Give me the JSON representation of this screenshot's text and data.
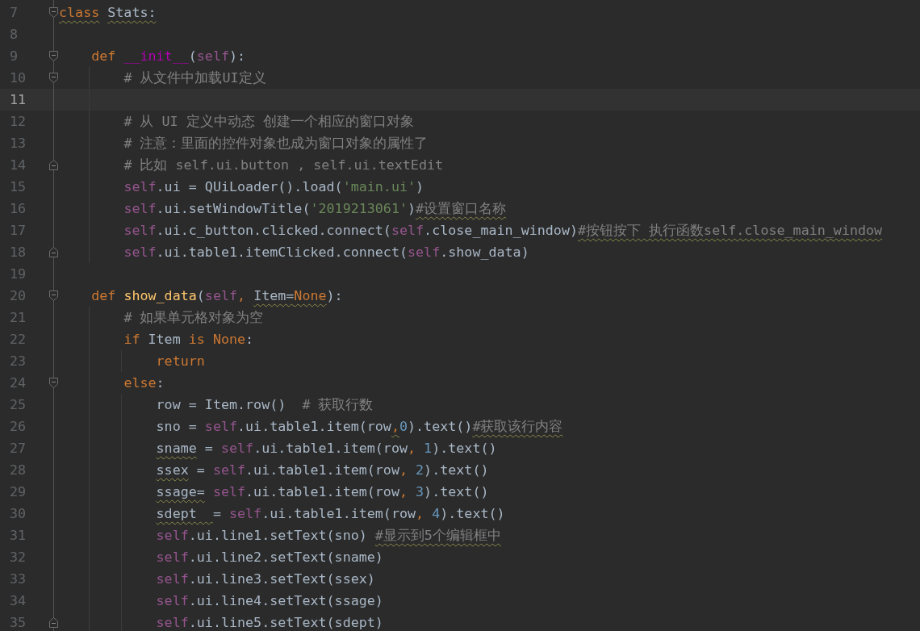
{
  "editor": {
    "lines": [
      {
        "number": "7",
        "kind": "fold-start",
        "selected": false,
        "tokens": [
          {
            "kind": "keyword",
            "text": "class",
            "wavy": true
          },
          {
            "kind": "plain",
            "text": " Stats:",
            "wavy": true
          }
        ]
      },
      {
        "number": "8",
        "kind": "plain",
        "selected": false
      },
      {
        "number": "9",
        "kind": "fold-start",
        "selected": false,
        "tokens": [
          {
            "kind": "keyword",
            "text": "    def "
          },
          {
            "kind": "magic",
            "text": "__init__"
          },
          {
            "kind": "plain",
            "text": "("
          },
          {
            "kind": "self",
            "text": "self"
          },
          {
            "kind": "plain",
            "text": "):"
          }
        ]
      },
      {
        "number": "10",
        "kind": "fold-start",
        "selected": false,
        "tokens": [
          {
            "kind": "comment",
            "text": "        # 从文件中加载UI定义"
          }
        ]
      },
      {
        "number": "11",
        "kind": "plain",
        "selected": true
      },
      {
        "number": "12",
        "kind": "plain",
        "selected": false,
        "tokens": [
          {
            "kind": "comment",
            "text": "        # 从 UI 定义中动态 创建一个相应的窗口对象"
          }
        ]
      },
      {
        "number": "13",
        "kind": "plain",
        "selected": false,
        "tokens": [
          {
            "kind": "comment",
            "text": "        # 注意：里面的控件对象也成为窗口对象的属性了"
          }
        ]
      },
      {
        "number": "14",
        "kind": "fold-end",
        "selected": false,
        "tokens": [
          {
            "kind": "comment",
            "text": "        # 比如 self.ui.button , self.ui.textEdit"
          }
        ]
      },
      {
        "number": "15",
        "kind": "plain",
        "selected": false,
        "tokens": [
          {
            "kind": "self",
            "text": "        self"
          },
          {
            "kind": "plain",
            "text": ".ui = QUiLoader().load("
          },
          {
            "kind": "string",
            "text": "'main.ui'"
          },
          {
            "kind": "plain",
            "text": ")"
          }
        ]
      },
      {
        "number": "16",
        "kind": "plain",
        "selected": false,
        "tokens": [
          {
            "kind": "self",
            "text": "        self"
          },
          {
            "kind": "plain",
            "text": ".ui.setWindowTitle("
          },
          {
            "kind": "string",
            "text": "'2019213061'"
          },
          {
            "kind": "plain",
            "text": ")"
          },
          {
            "kind": "comment",
            "text": "#设置窗口名称",
            "wavy": true
          }
        ]
      },
      {
        "number": "17",
        "kind": "plain",
        "selected": false,
        "tokens": [
          {
            "kind": "self",
            "text": "        self"
          },
          {
            "kind": "plain",
            "text": ".ui.c_button.clicked.connect("
          },
          {
            "kind": "self",
            "text": "self"
          },
          {
            "kind": "plain",
            "text": ".close_main_window)"
          },
          {
            "kind": "comment",
            "text": "#按钮按下 执行函数self.close_main_window",
            "wavy": true
          }
        ]
      },
      {
        "number": "18",
        "kind": "fold-end",
        "selected": false,
        "tokens": [
          {
            "kind": "self",
            "text": "        self"
          },
          {
            "kind": "plain",
            "text": ".ui.table1.itemClicked.connect("
          },
          {
            "kind": "self",
            "text": "self"
          },
          {
            "kind": "plain",
            "text": ".show_data)"
          }
        ]
      },
      {
        "number": "19",
        "kind": "plain",
        "selected": false
      },
      {
        "number": "20",
        "kind": "fold-start",
        "selected": false,
        "tokens": [
          {
            "kind": "keyword",
            "text": "    def "
          },
          {
            "kind": "function",
            "text": "show_data"
          },
          {
            "kind": "plain",
            "text": "("
          },
          {
            "kind": "self",
            "text": "self"
          },
          {
            "kind": "keyword",
            "text": ", "
          },
          {
            "kind": "plain",
            "text": "Item=",
            "wavy": true
          },
          {
            "kind": "keyword",
            "text": "None",
            "wavy": true
          },
          {
            "kind": "plain",
            "text": "):"
          }
        ]
      },
      {
        "number": "21",
        "kind": "plain",
        "selected": false,
        "tokens": [
          {
            "kind": "comment",
            "text": "        # 如果单元格对象为空"
          }
        ]
      },
      {
        "number": "22",
        "kind": "plain",
        "selected": false,
        "tokens": [
          {
            "kind": "keyword",
            "text": "        if "
          },
          {
            "kind": "plain",
            "text": "Item "
          },
          {
            "kind": "keyword",
            "text": "is None"
          },
          {
            "kind": "plain",
            "text": ":"
          }
        ]
      },
      {
        "number": "23",
        "kind": "plain",
        "selected": false,
        "tokens": [
          {
            "kind": "keyword",
            "text": "            return"
          }
        ]
      },
      {
        "number": "24",
        "kind": "fold-start",
        "selected": false,
        "tokens": [
          {
            "kind": "keyword",
            "text": "        else"
          },
          {
            "kind": "plain",
            "text": ":"
          }
        ]
      },
      {
        "number": "25",
        "kind": "plain",
        "selected": false,
        "tokens": [
          {
            "kind": "plain",
            "text": "            row = Item.row()  "
          },
          {
            "kind": "comment",
            "text": "# 获取行数"
          }
        ]
      },
      {
        "number": "26",
        "kind": "plain",
        "selected": false,
        "tokens": [
          {
            "kind": "plain",
            "text": "            sno = "
          },
          {
            "kind": "self",
            "text": "self"
          },
          {
            "kind": "plain",
            "text": ".ui.table1.item(row"
          },
          {
            "kind": "keyword",
            "text": ",",
            "wavy": true
          },
          {
            "kind": "number",
            "text": "0"
          },
          {
            "kind": "plain",
            "text": ").text()"
          },
          {
            "kind": "comment",
            "text": "#获取该行内容",
            "wavy": true
          }
        ]
      },
      {
        "number": "27",
        "kind": "plain",
        "selected": false,
        "tokens": [
          {
            "kind": "plain",
            "text": "            sname",
            "wavy": true
          },
          {
            "kind": "plain",
            "text": " = "
          },
          {
            "kind": "self",
            "text": "self"
          },
          {
            "kind": "plain",
            "text": ".ui.table1.item(row"
          },
          {
            "kind": "keyword",
            "text": ", "
          },
          {
            "kind": "number",
            "text": "1"
          },
          {
            "kind": "plain",
            "text": ").text()"
          }
        ]
      },
      {
        "number": "28",
        "kind": "plain",
        "selected": false,
        "tokens": [
          {
            "kind": "plain",
            "text": "            ssex",
            "wavy": true
          },
          {
            "kind": "plain",
            "text": " = "
          },
          {
            "kind": "self",
            "text": "self"
          },
          {
            "kind": "plain",
            "text": ".ui.table1.item(row"
          },
          {
            "kind": "keyword",
            "text": ", "
          },
          {
            "kind": "number",
            "text": "2"
          },
          {
            "kind": "plain",
            "text": ").text()"
          }
        ]
      },
      {
        "number": "29",
        "kind": "plain",
        "selected": false,
        "tokens": [
          {
            "kind": "plain",
            "text": "            ssage=",
            "wavy": true
          },
          {
            "kind": "self",
            "text": " self"
          },
          {
            "kind": "plain",
            "text": ".ui.table1.item(row"
          },
          {
            "kind": "keyword",
            "text": ", "
          },
          {
            "kind": "number",
            "text": "3"
          },
          {
            "kind": "plain",
            "text": ").text()"
          }
        ]
      },
      {
        "number": "30",
        "kind": "plain",
        "selected": false,
        "tokens": [
          {
            "kind": "plain",
            "text": "            sdept  ",
            "wavy": true
          },
          {
            "kind": "plain",
            "text": "= "
          },
          {
            "kind": "self",
            "text": "self"
          },
          {
            "kind": "plain",
            "text": ".ui.table1.item(row"
          },
          {
            "kind": "keyword",
            "text": ", "
          },
          {
            "kind": "number",
            "text": "4"
          },
          {
            "kind": "plain",
            "text": ").text()"
          }
        ]
      },
      {
        "number": "31",
        "kind": "plain",
        "selected": false,
        "tokens": [
          {
            "kind": "self",
            "text": "            self"
          },
          {
            "kind": "plain",
            "text": ".ui.line1.setText(sno)"
          },
          {
            "kind": "comment",
            "text": " #显示到5个编辑框中",
            "wavy": true
          }
        ]
      },
      {
        "number": "32",
        "kind": "plain",
        "selected": false,
        "tokens": [
          {
            "kind": "self",
            "text": "            self"
          },
          {
            "kind": "plain",
            "text": ".ui.line2.setText(sname)"
          }
        ]
      },
      {
        "number": "33",
        "kind": "plain",
        "selected": false,
        "tokens": [
          {
            "kind": "self",
            "text": "            self"
          },
          {
            "kind": "plain",
            "text": ".ui.line3.setText(ssex)"
          }
        ]
      },
      {
        "number": "34",
        "kind": "plain",
        "selected": false,
        "tokens": [
          {
            "kind": "self",
            "text": "            self"
          },
          {
            "kind": "plain",
            "text": ".ui.line4.setText(ssage)"
          }
        ]
      },
      {
        "number": "35",
        "kind": "fold-end",
        "selected": false,
        "tokens": [
          {
            "kind": "self",
            "text": "            self"
          },
          {
            "kind": "plain",
            "text": ".ui.line5.setText(sdept)"
          }
        ]
      }
    ]
  }
}
